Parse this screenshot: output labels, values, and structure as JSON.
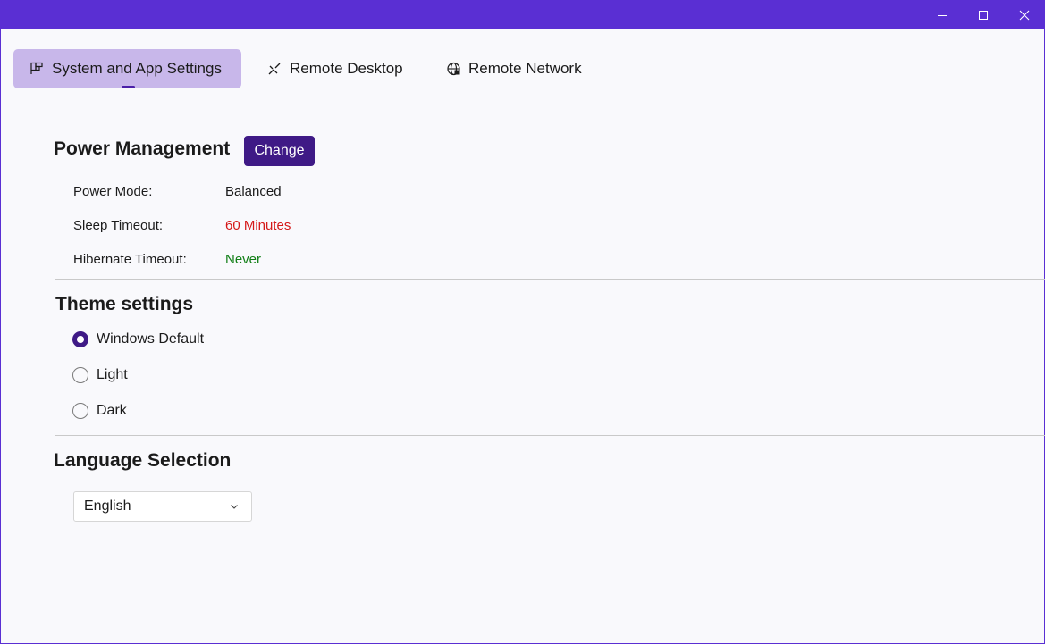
{
  "window": {
    "controls": [
      "minimize-icon",
      "maximize-icon",
      "close-icon"
    ]
  },
  "tabs": [
    {
      "label": "System and App Settings",
      "icon": "settings-panel-icon",
      "selected": true
    },
    {
      "label": "Remote Desktop",
      "icon": "remote-connect-icon",
      "selected": false
    },
    {
      "label": "Remote Network",
      "icon": "globe-network-icon",
      "selected": false
    }
  ],
  "power": {
    "title": "Power Management",
    "change_label": "Change",
    "rows": [
      {
        "label": "Power Mode:",
        "value": "Balanced",
        "color": "#1b1b1b"
      },
      {
        "label": "Sleep Timeout:",
        "value": "60 Minutes",
        "color": "#d51818"
      },
      {
        "label": "Hibernate Timeout:",
        "value": "Never",
        "color": "#127f17"
      }
    ]
  },
  "theme": {
    "title": "Theme settings",
    "options": [
      {
        "label": "Windows Default",
        "checked": true
      },
      {
        "label": "Light",
        "checked": false
      },
      {
        "label": "Dark",
        "checked": false
      }
    ]
  },
  "language": {
    "title": "Language Selection",
    "selected": "English"
  },
  "colors": {
    "titlebar": "#5a2fd3",
    "accent": "#3f1a86",
    "tab_selected_bg": "#c8b7ea"
  }
}
